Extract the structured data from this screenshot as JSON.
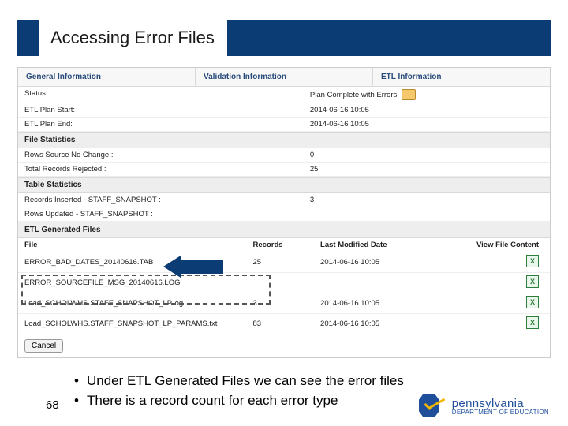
{
  "slide": {
    "title": "Accessing Error Files",
    "page_number": "68",
    "bullets": [
      "Under ETL Generated Files we can see the error files",
      "There is a record count for each error type"
    ]
  },
  "tabs": {
    "general": "General Information",
    "validation": "Validation Information",
    "etl": "ETL Information"
  },
  "status": {
    "label": "Status:",
    "value": "Plan Complete with Errors",
    "start_label": "ETL Plan Start:",
    "start_value": "2014-06-16 10:05",
    "end_label": "ETL Plan End:",
    "end_value": "2014-06-16 10:05"
  },
  "file_stats": {
    "heading": "File Statistics",
    "rows_nochange_label": "Rows Source No Change :",
    "rows_nochange_value": "0",
    "rejected_label": "Total Records Rejected :",
    "rejected_value": "25"
  },
  "table_stats": {
    "heading": "Table Statistics",
    "inserted_label": "Records Inserted - STAFF_SNAPSHOT :",
    "inserted_value": "3",
    "updated_label": "Rows Updated - STAFF_SNAPSHOT :",
    "updated_value": ""
  },
  "gen_files": {
    "heading": "ETL Generated Files",
    "cols": {
      "file": "File",
      "records": "Records",
      "modified": "Last Modified Date",
      "view": "View File Content"
    },
    "rows": [
      {
        "file": "ERROR_BAD_DATES_20140616.TAB",
        "records": "25",
        "modified": "2014-06-16 10:05"
      },
      {
        "file": "ERROR_SOURCEFILE_MSG_20140616.LOG",
        "records": "",
        "modified": ""
      },
      {
        "file": "Load_SCHOLWHS.STAFF_SNAPSHOT_LP.log",
        "records": "3",
        "modified": "2014-06-16 10:05"
      },
      {
        "file": "Load_SCHOLWHS.STAFF_SNAPSHOT_LP_PARAMS.txt",
        "records": "83",
        "modified": "2014-06-16 10:05"
      }
    ]
  },
  "buttons": {
    "cancel": "Cancel"
  },
  "logo": {
    "brand": "pennsylvania",
    "dept": "DEPARTMENT OF EDUCATION"
  }
}
